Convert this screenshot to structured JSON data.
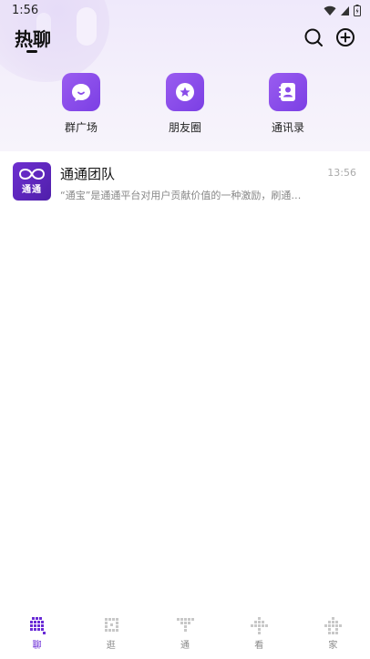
{
  "status_bar": {
    "time": "1:56"
  },
  "header": {
    "title": "热聊"
  },
  "quick_actions": [
    {
      "label": "群广场",
      "icon": "chat-bubble-icon"
    },
    {
      "label": "朋友圈",
      "icon": "star-circle-icon"
    },
    {
      "label": "通讯录",
      "icon": "contacts-book-icon"
    }
  ],
  "chats": [
    {
      "name": "通通团队",
      "avatar_text": "通通",
      "time": "13:56",
      "preview": "“通宝”是通通平台对用户贡献价值的一种激励，刷通…"
    }
  ],
  "tabs": [
    {
      "label": "聊",
      "active": true
    },
    {
      "label": "逛",
      "active": false
    },
    {
      "label": "通",
      "active": false
    },
    {
      "label": "看",
      "active": false
    },
    {
      "label": "家",
      "active": false
    }
  ],
  "colors": {
    "accent": "#6a2bd6",
    "icon_gradient_start": "#9a5cf0",
    "icon_gradient_end": "#7b3fe4"
  }
}
